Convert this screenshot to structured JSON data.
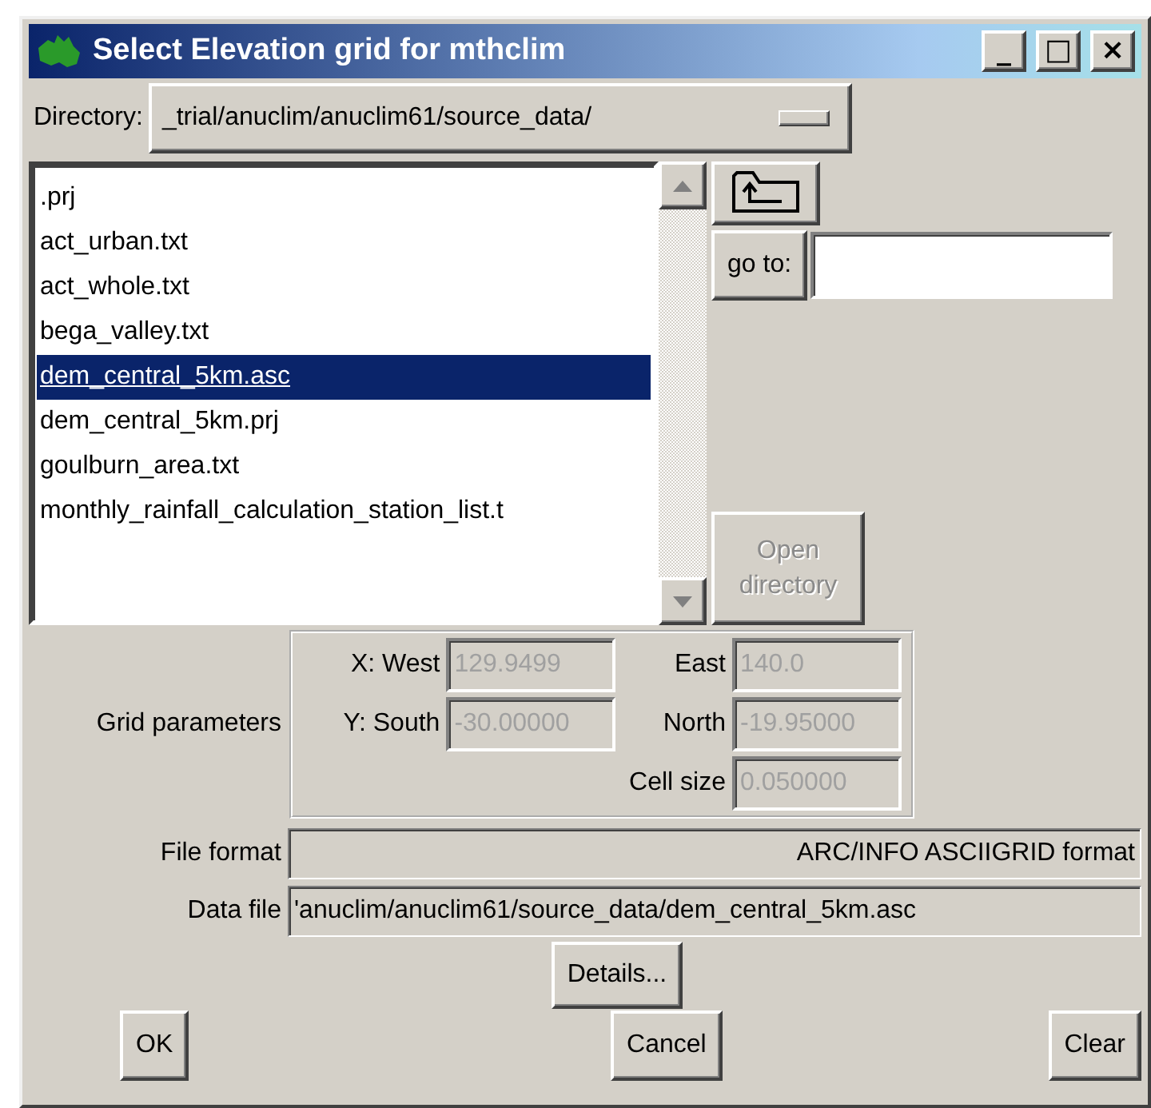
{
  "window": {
    "title": "Select Elevation grid for mthclim",
    "controls": [
      "_",
      "□",
      "×"
    ]
  },
  "directory": {
    "label": "Directory:",
    "value": "_trial/anuclim/anuclim61/source_data/"
  },
  "file_list": {
    "items": [
      {
        "label": ".prj",
        "selected": false
      },
      {
        "label": "act_urban.txt",
        "selected": false
      },
      {
        "label": "act_whole.txt",
        "selected": false
      },
      {
        "label": "bega_valley.txt",
        "selected": false
      },
      {
        "label": "dem_central_5km.asc",
        "selected": true
      },
      {
        "label": "dem_central_5km.prj",
        "selected": false
      },
      {
        "label": "goulburn_area.txt",
        "selected": false
      },
      {
        "label": "monthly_rainfall_calculation_station_list.t",
        "selected": false
      }
    ]
  },
  "goto": {
    "label": "go to:"
  },
  "open_directory": {
    "label": "Open directory",
    "disabled": true
  },
  "grid_parameters": {
    "label": "Grid parameters",
    "fields": [
      {
        "label": "X: West",
        "value": "129.9499",
        "disabled": true
      },
      {
        "label": "East",
        "value": "140.0",
        "disabled": true
      },
      {
        "label": "Y: South",
        "value": "-30.00000",
        "disabled": true
      },
      {
        "label": "North",
        "value": "-19.95000",
        "disabled": true
      },
      {
        "label": "Cell size",
        "value": "0.050000",
        "disabled": true
      }
    ]
  },
  "file_format": {
    "label": "File format",
    "value": "ARC/INFO ASCIIGRID format"
  },
  "data_file": {
    "label": "Data file",
    "value": "'anuclim/anuclim61/source_data/dem_central_5km.asc"
  },
  "buttons": {
    "details": "Details...",
    "ok": "OK",
    "cancel": "Cancel",
    "clear": "Clear"
  }
}
